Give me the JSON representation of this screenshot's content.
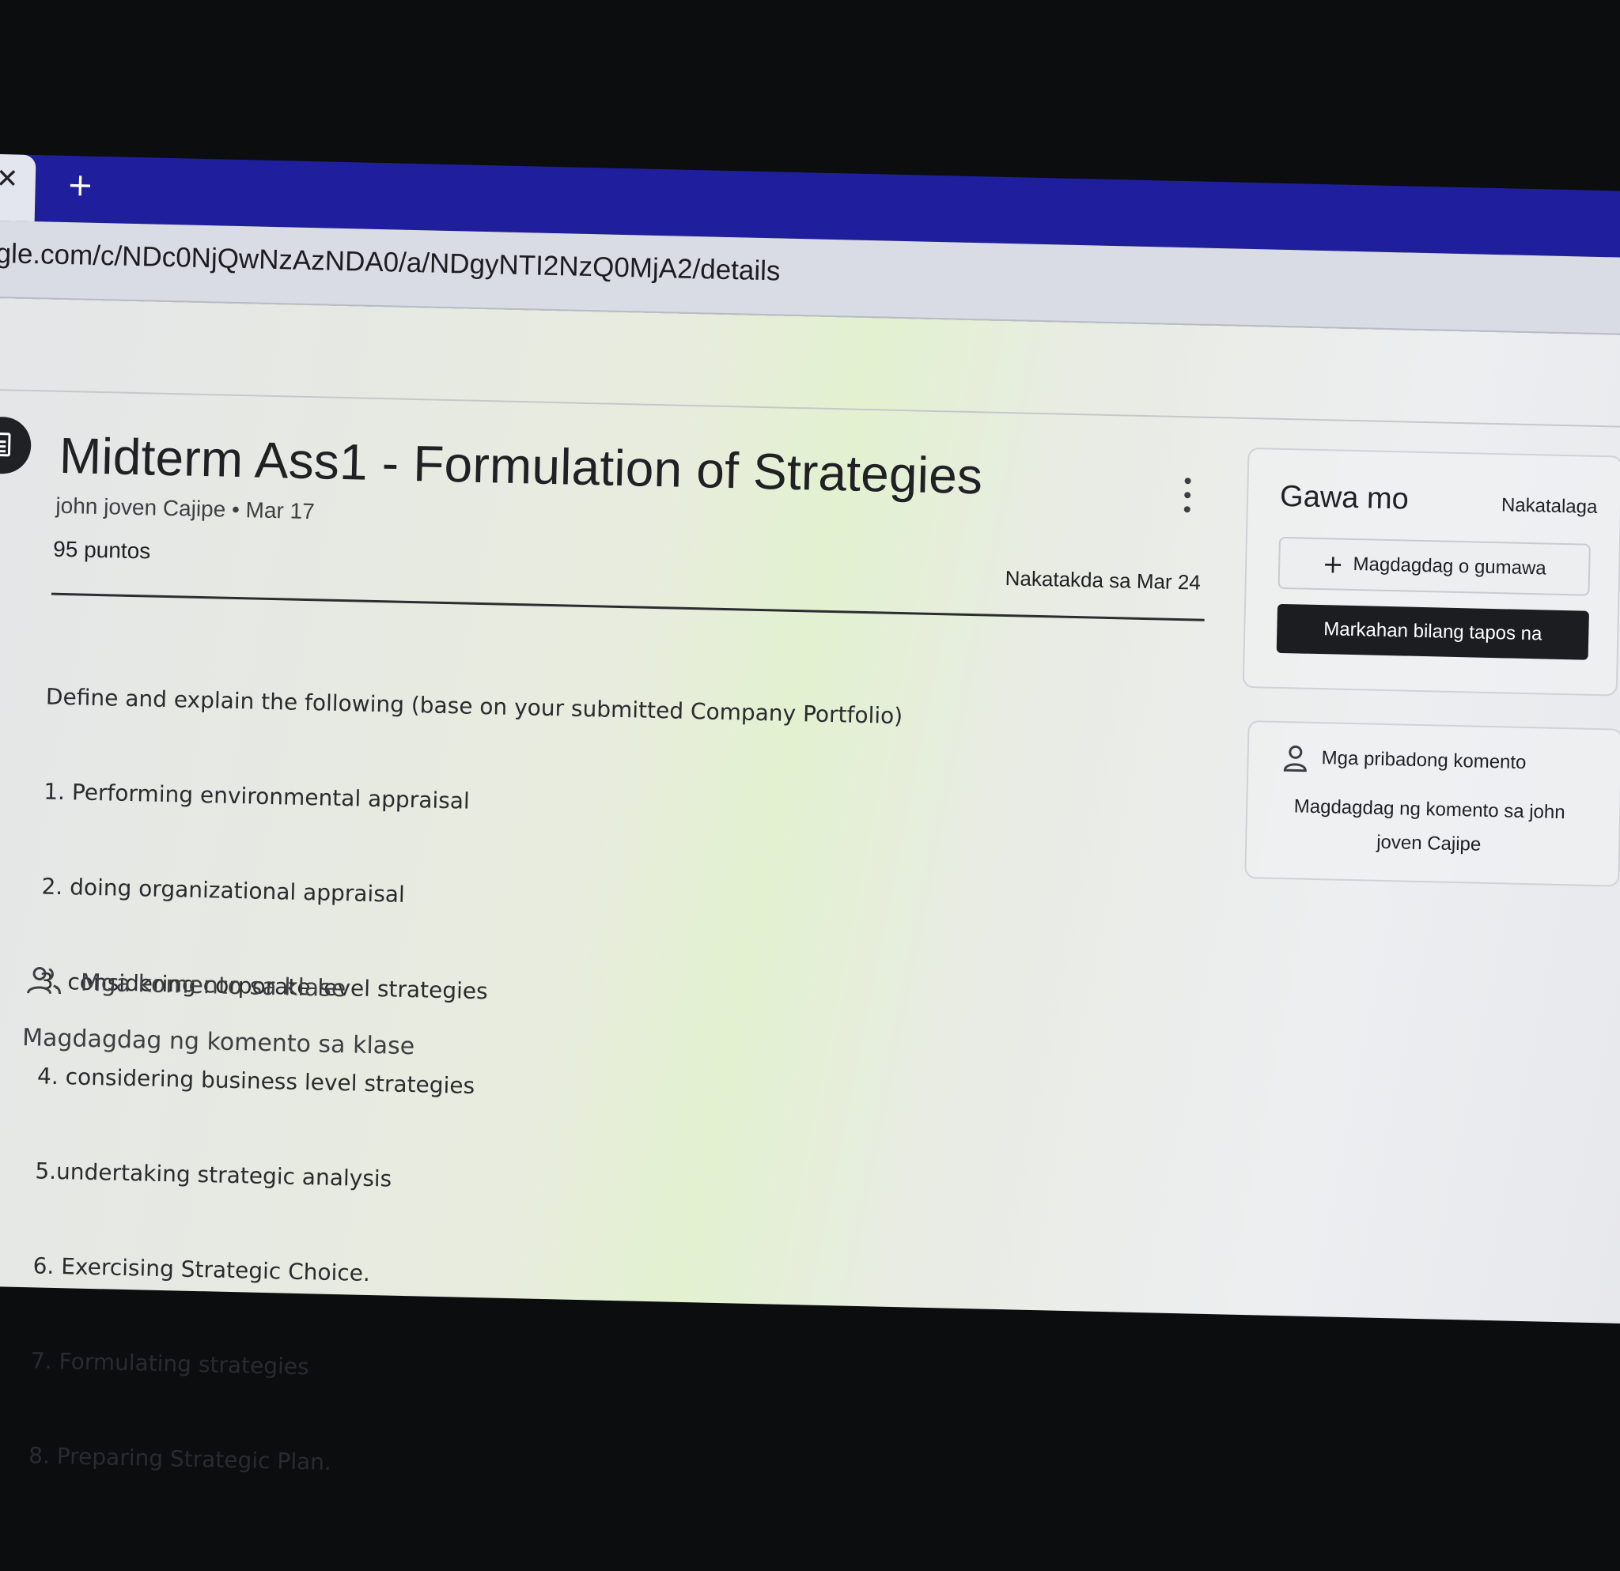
{
  "browser": {
    "tab_close_glyph": "✕",
    "new_tab_glyph": "+",
    "url": "gle.com/c/NDc0NjQwNzAzNDA0/a/NDgyNTI2NzQ0MjA2/details"
  },
  "assignment": {
    "icon": "assignment-icon",
    "title": "Midterm Ass1 - Formulation of Strategies",
    "meta": "john joven Cajipe • Mar 17",
    "points": "95 puntos",
    "due": "Nakatakda sa Mar 24",
    "instructions": [
      "Define and explain the following (base on your submitted Company Portfolio)",
      "1. Performing environmental appraisal",
      "2. doing organizational appraisal",
      "3. considering corporate level strategies",
      "4. considering business level strategies",
      "5.undertaking strategic analysis",
      "6. Exercising Strategic Choice.",
      "7. Formulating strategies",
      "8. Preparing Strategic Plan."
    ]
  },
  "class_comments": {
    "icon": "people-icon",
    "label": "Mga komento sa klase",
    "add": "Magdagdag ng komento sa klase"
  },
  "your_work": {
    "title": "Gawa mo",
    "status": "Nakatalaga",
    "add_button": "Magdagdag o gumawa",
    "mark_done_button": "Markahan bilang tapos na"
  },
  "private_comments": {
    "icon": "person-icon",
    "label": "Mga pribadong komento",
    "add": "Magdagdag ng komento sa john joven Cajipe"
  },
  "colors": {
    "tabstrip": "#1f1f9e",
    "primary_button": "#1b1d20"
  }
}
